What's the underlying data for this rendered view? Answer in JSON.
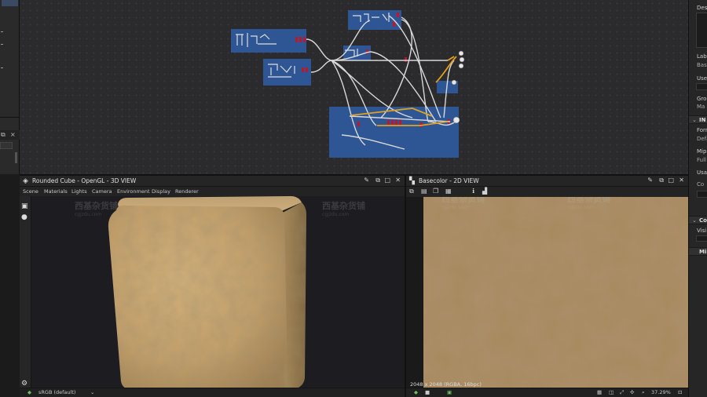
{
  "left_panel": {
    "collapse_label": "×"
  },
  "properties": {
    "description_label": "Des",
    "label_label": "Lab",
    "label_value": "Bas",
    "user_label": "Use",
    "group_label": "Gro",
    "group_value": "Ma",
    "input_section": "IN",
    "format_label": "Form",
    "format_value": "Defa",
    "mipmaps_label": "Mip",
    "mipmaps_value": "Full",
    "usage_label": "Usa",
    "usage_value": "Co",
    "color_section": "Co",
    "visible_label": "Visi",
    "misc_section": "Mi"
  },
  "view3d": {
    "title": "Rounded Cube - OpenGL - 3D VIEW",
    "menu": [
      "Scene",
      "Materials",
      "Lights",
      "Camera",
      "Environment",
      "Display",
      "Renderer"
    ],
    "colorspace": "sRGB (default)"
  },
  "view2d": {
    "title": "Basecolor - 2D VIEW",
    "resolution": "2048 x 2048 (RGBA, 16bpc)",
    "zoom": "37.29%"
  },
  "watermark": {
    "brand": "西基杂货铺",
    "site": "cgjzdu.com"
  },
  "colors": {
    "node_blue": "#2f5ea8",
    "link_orange": "#e2a01e",
    "accent_red": "#c0162a",
    "sand": "#c7a46e"
  }
}
